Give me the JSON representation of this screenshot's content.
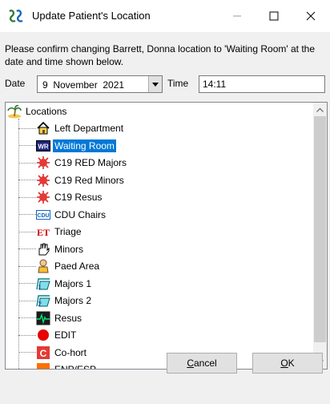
{
  "window": {
    "title": "Update Patient's Location",
    "minimize_icon": "minimize-icon",
    "maximize_icon": "maximize-icon",
    "close_icon": "close-icon"
  },
  "dialog": {
    "message": "Please confirm changing Barrett, Donna location to 'Waiting Room' at the date and time shown below.",
    "date_label": "Date",
    "date_value": "9  November  2021",
    "time_label": "Time",
    "time_value": "14:11"
  },
  "tree": {
    "root_label": "Locations",
    "items": [
      {
        "label": "Left Department",
        "icon": "house-icon",
        "selected": false
      },
      {
        "label": "Waiting Room",
        "icon": "wr-icon",
        "selected": true
      },
      {
        "label": "C19 RED Majors",
        "icon": "virus-icon",
        "selected": false
      },
      {
        "label": "C19 Red Minors",
        "icon": "virus-icon",
        "selected": false
      },
      {
        "label": "C19 Resus",
        "icon": "virus-icon",
        "selected": false
      },
      {
        "label": "CDU Chairs",
        "icon": "cdu-icon",
        "selected": false
      },
      {
        "label": "Triage",
        "icon": "et-icon",
        "selected": false
      },
      {
        "label": "Minors",
        "icon": "hand-icon",
        "selected": false
      },
      {
        "label": "Paed Area",
        "icon": "child-icon",
        "selected": false
      },
      {
        "label": "Majors 1",
        "icon": "bed-1-icon",
        "selected": false
      },
      {
        "label": "Majors 2",
        "icon": "bed-2-icon",
        "selected": false
      },
      {
        "label": "Resus",
        "icon": "ecg-icon",
        "selected": false
      },
      {
        "label": "EDIT",
        "icon": "red-dot-icon",
        "selected": false
      },
      {
        "label": "Co-hort",
        "icon": "c-box-icon",
        "selected": false
      },
      {
        "label": "ENP/ESP",
        "icon": "enp-icon",
        "selected": false
      }
    ]
  },
  "buttons": {
    "cancel_label": "Cancel",
    "cancel_mnemonic": "C",
    "ok_label": "OK",
    "ok_mnemonic": "O"
  },
  "colors": {
    "selection": "#0078d7",
    "dialog_bg": "#f0f0f0"
  }
}
